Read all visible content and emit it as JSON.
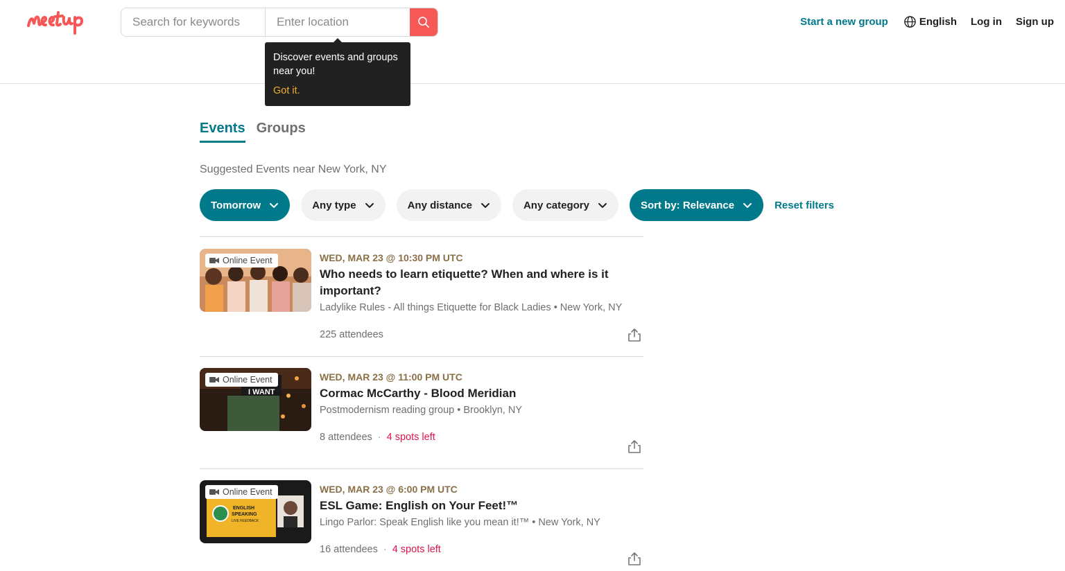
{
  "header": {
    "logo_text": "meetup",
    "search_placeholder": "Search for keywords",
    "location_placeholder": "Enter location",
    "start_group": "Start a new group",
    "language": "English",
    "login": "Log in",
    "signup": "Sign up"
  },
  "tooltip": {
    "text": "Discover events and groups near you!",
    "action": "Got it."
  },
  "tabs": [
    {
      "label": "Events",
      "active": true
    },
    {
      "label": "Groups",
      "active": false
    }
  ],
  "suggested": "Suggested Events near New York, NY",
  "filters": {
    "date": "Tomorrow",
    "type": "Any type",
    "distance": "Any distance",
    "category": "Any category",
    "sort": "Sort by: Relevance",
    "reset": "Reset filters"
  },
  "events": [
    {
      "badge": "Online Event",
      "date": "WED, MAR 23 @ 10:30 PM UTC",
      "title": "Who needs to learn etiquette? When and where is it important?",
      "group": "Ladylike Rules - All things Etiquette for Black Ladies • New York, NY",
      "attendees": "225 attendees",
      "spots": ""
    },
    {
      "badge": "Online Event",
      "date": "WED, MAR 23 @ 11:00 PM UTC",
      "title": "Cormac McCarthy - Blood Meridian",
      "group": "Postmodernism reading group • Brooklyn, NY",
      "attendees": "8 attendees",
      "spots": "4 spots left"
    },
    {
      "badge": "Online Event",
      "date": "WED, MAR 23 @ 6:00 PM UTC",
      "title": "ESL Game: English on Your Feet!™",
      "group": "Lingo Parlor: Speak English like you mean it!™ • New York, NY",
      "attendees": "16 attendees",
      "spots": "4 spots left"
    }
  ],
  "colors": {
    "brand_red": "#f65858",
    "teal": "#00798a",
    "date_brown": "#8a6f47",
    "spots_red": "#e0144c"
  }
}
